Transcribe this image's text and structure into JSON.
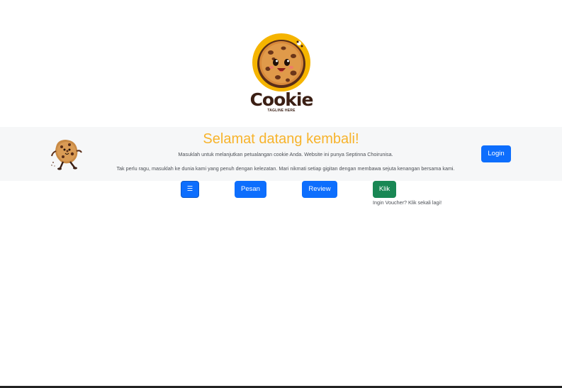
{
  "logo": {
    "word": "Cookie",
    "tagline": "TAGLINE HERE"
  },
  "welcome": {
    "title": "Selamat datang kembali!",
    "line1": "Masuklah untuk melanjutkan petualangan cookie Anda. Website ini punya Septinna Choirunisa.",
    "line2": "Tak perlu ragu, masuklah ke dunia kami yang penuh dengan kelezatan. Mari nikmati setiap gigitan dengan membawa sejuta kenangan bersama kami.",
    "login_label": "Login"
  },
  "actions": {
    "menu_label": "☰",
    "pesan_label": "Pesan",
    "review_label": "Review",
    "klik_label": "Klik",
    "voucher_text": "Ingin Voucher? Klik sekali lagi!"
  },
  "colors": {
    "title": "#f7b32b",
    "primary": "#0d6efd",
    "success": "#198754",
    "band": "#f6f7f8"
  },
  "icons": {
    "logo": "cookie-logo-icon",
    "mascot": "cookie-mascot-icon",
    "menu": "hamburger-menu-icon"
  }
}
